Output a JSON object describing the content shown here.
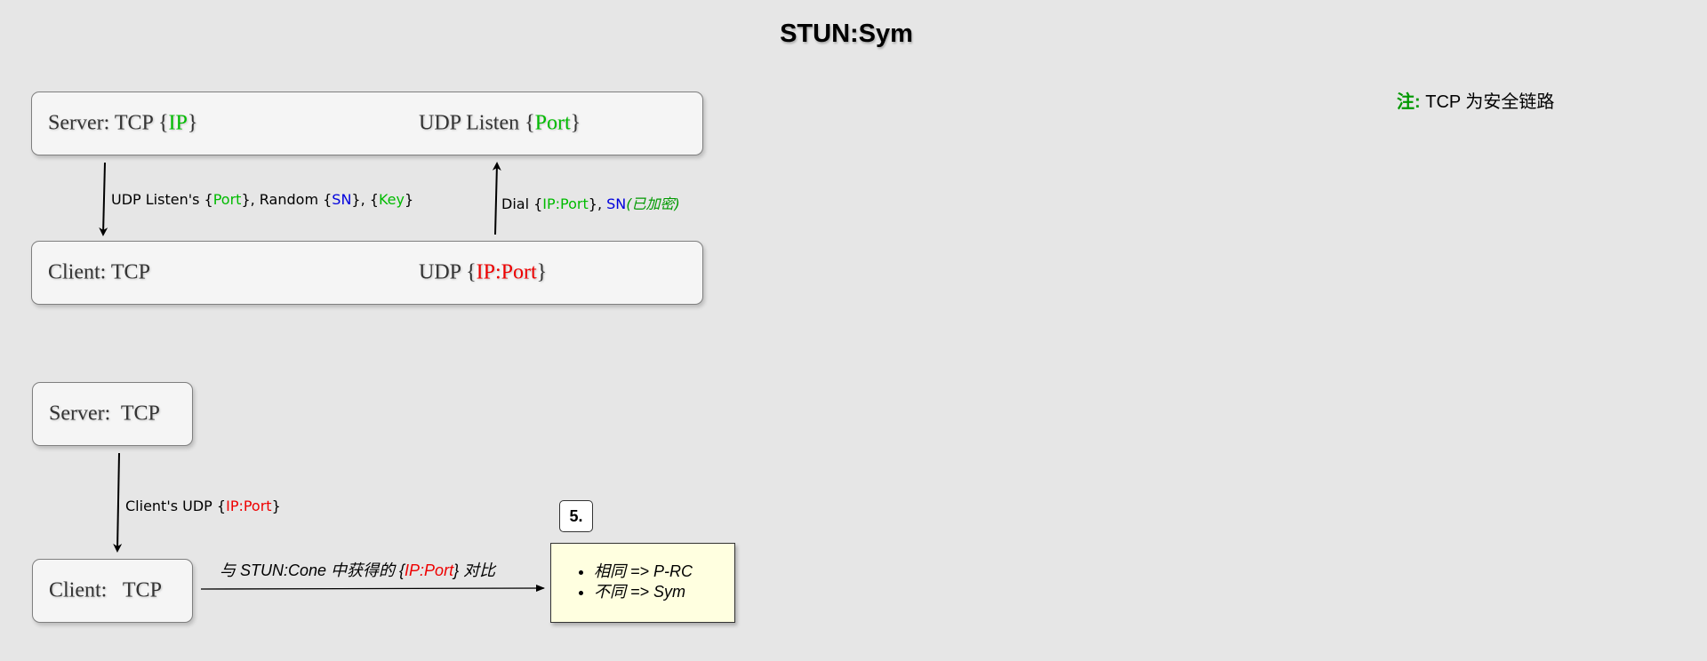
{
  "title": "STUN:Sym",
  "note": {
    "key": "注:",
    "text": " TCP 为安全链路"
  },
  "diagram1": {
    "server_box": {
      "label": "Server: TCP {",
      "ip": "IP",
      "close": "}",
      "udp_label": "UDP Listen {",
      "port": "Port",
      "udp_close": "}"
    },
    "client_box": {
      "label": "Client: TCP",
      "udp_label": "UDP {",
      "ipport": "IP:Port",
      "udp_close": "}"
    },
    "down_arrow_label": {
      "p1": "UDP Listen's {",
      "port": "Port",
      "p2": "}, Random {",
      "sn": "SN",
      "p3": "}, {",
      "key": "Key",
      "p4": "}"
    },
    "up_arrow_label": {
      "p1": "Dial {",
      "ipport": "IP:Port",
      "p2": "}, ",
      "sn": "SN",
      "encrypted": "(已加密)"
    }
  },
  "diagram2": {
    "server_box": {
      "label": "Server:  TCP"
    },
    "client_box": {
      "label": "Client:   TCP"
    },
    "down_arrow_label": {
      "p1": "Client's UDP {",
      "ipport": "IP:Port",
      "p2": "}"
    },
    "compare_label": {
      "p1": "与 STUN:Cone 中获得的 {",
      "ipport": "IP:Port",
      "p2": "} 对比"
    },
    "step_badge": "5.",
    "results": [
      "相同 => P-RC",
      "不同 => Sym"
    ]
  }
}
